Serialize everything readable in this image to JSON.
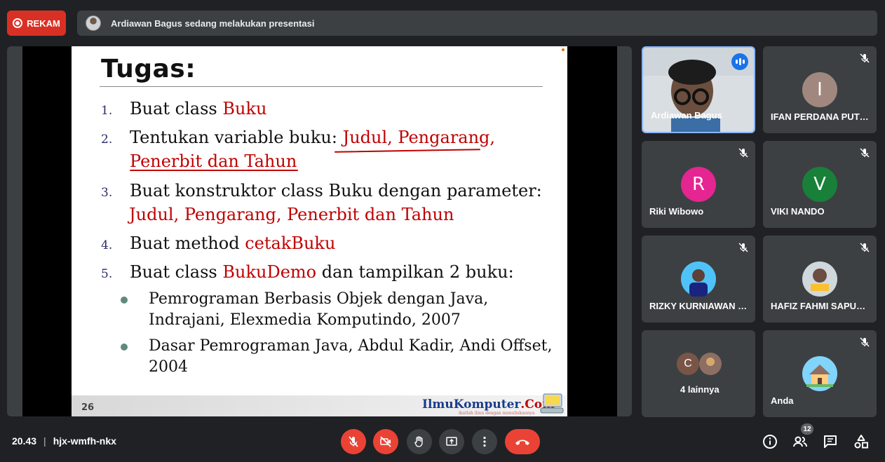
{
  "topbar": {
    "record_label": "REKAM",
    "presenting_text": "Ardiawan Bagus sedang melakukan presentasi"
  },
  "slide": {
    "title": "Tugas:",
    "items": [
      {
        "num": "1.",
        "text": "Buat class ",
        "highlight": "Buku"
      },
      {
        "num": "2.",
        "text": "Tentukan variable  buku: ",
        "highlight": "Judul, Pengarang,",
        "line2": "Penerbit dan Tahun"
      },
      {
        "num": "3.",
        "text": "Buat konstruktor  class Buku dengan parameter:",
        "line2": "Judul, Pengarang, Penerbit dan Tahun"
      },
      {
        "num": "4.",
        "text": "Buat method ",
        "highlight": "cetakBuku"
      },
      {
        "num": "5.",
        "text": "Buat class ",
        "highlight": "BukuDemo",
        "rest": " dan tampilkan 2 buku:"
      }
    ],
    "books": [
      {
        "line1": "Pemrograman Berbasis Objek dengan Java,",
        "line2": "Indrajani, Elexmedia Komputindo, 2007"
      },
      {
        "line1": "Dasar Pemrograman Java, Abdul Kadir, Andi Offset,",
        "line2": "2004"
      }
    ],
    "page_number": "26",
    "brand_a": "IlmuKomputer",
    "brand_b": ".Com",
    "brand_tagline": "ikatlah ilmu dengan menuliskannya"
  },
  "participants": [
    {
      "name": "Ardiawan Bagus",
      "type": "video",
      "speaking": true
    },
    {
      "name": "IFAN PERDANA PUTRA",
      "initial": "I",
      "color": "#a1887f",
      "muted": true
    },
    {
      "name": "Riki Wibowo",
      "initial": "R",
      "color": "#e52592",
      "muted": true
    },
    {
      "name": "VIKI NANDO",
      "initial": "V",
      "color": "#188038",
      "muted": true
    },
    {
      "name": "RIZKY KURNIAWAN S...",
      "type": "photo",
      "muted": true
    },
    {
      "name": "HAFIZ FAHMI SAPUTRO",
      "type": "photo",
      "muted": true
    },
    {
      "name": "4 lainnya",
      "type": "group",
      "initial": "C"
    },
    {
      "name": "Anda",
      "type": "photo",
      "muted": true
    }
  ],
  "bottombar": {
    "time": "20.43",
    "meeting_code": "hjx-wmfh-nkx",
    "people_count": "12"
  },
  "colors": {
    "end_call": "#ea4335",
    "active_border": "#8ab4f8",
    "speaking": "#1a73e8"
  }
}
